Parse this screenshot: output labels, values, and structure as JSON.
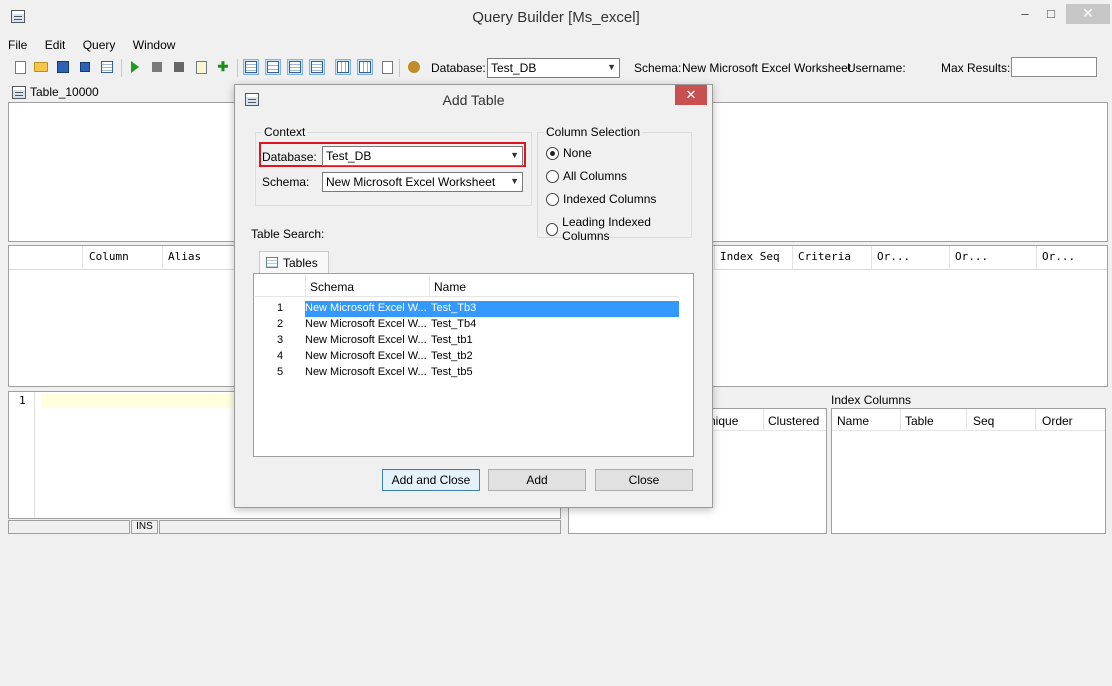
{
  "window": {
    "title": "Query Builder [Ms_excel]",
    "minimize": "–",
    "maximize": "□",
    "close": "✕"
  },
  "menu": [
    "File",
    "Edit",
    "Query",
    "Window"
  ],
  "toolbar": {
    "database_label": "Database:",
    "database_value": "Test_DB",
    "schema_label": "Schema:",
    "schema_value": "New Microsoft Excel Worksheet",
    "username_label": "Username:",
    "max_results_label": "Max Results:",
    "max_results_value": ""
  },
  "table_tab": "Table_10000",
  "grid_columns": [
    "Column",
    "Alias",
    "Index Seq",
    "Criteria",
    "Or...",
    "Or...",
    "Or..."
  ],
  "editor": {
    "line_number": "1",
    "status_ins": "INS"
  },
  "index_columns": {
    "title": "Index Columns",
    "headers": [
      "Name",
      "Table",
      "Seq",
      "Order"
    ]
  },
  "indexes_partial_headers": [
    "nique",
    "Clustered"
  ],
  "dialog": {
    "title": "Add Table",
    "close": "✕",
    "context_title": "Context",
    "database_label": "Database:",
    "database_value": "Test_DB",
    "schema_label": "Schema:",
    "schema_value": "New Microsoft Excel Worksheet",
    "column_selection_title": "Column Selection",
    "column_options": [
      {
        "label": "None",
        "checked": true
      },
      {
        "label": "All Columns",
        "checked": false
      },
      {
        "label": "Indexed Columns",
        "checked": false
      },
      {
        "label": "Leading Indexed Columns",
        "checked": false
      }
    ],
    "table_search_label": "Table Search:",
    "tables_tab": "Tables",
    "table_headers": [
      "Schema",
      "Name"
    ],
    "rows": [
      {
        "num": "1",
        "schema": "New Microsoft Excel W...",
        "name": "Test_Tb3"
      },
      {
        "num": "2",
        "schema": "New Microsoft Excel W...",
        "name": "Test_Tb4"
      },
      {
        "num": "3",
        "schema": "New Microsoft Excel W...",
        "name": "Test_tb1"
      },
      {
        "num": "4",
        "schema": "New Microsoft Excel W...",
        "name": "Test_tb2"
      },
      {
        "num": "5",
        "schema": "New Microsoft Excel W...",
        "name": "Test_tb5"
      }
    ],
    "selected_row": 0,
    "buttons": {
      "add_close": "Add and Close",
      "add": "Add",
      "close": "Close"
    }
  },
  "colors": {
    "selection": "#3399ff",
    "highlight_border": "#e0141e",
    "editor_line": "#ffffe0",
    "close_red": "#c75050"
  }
}
